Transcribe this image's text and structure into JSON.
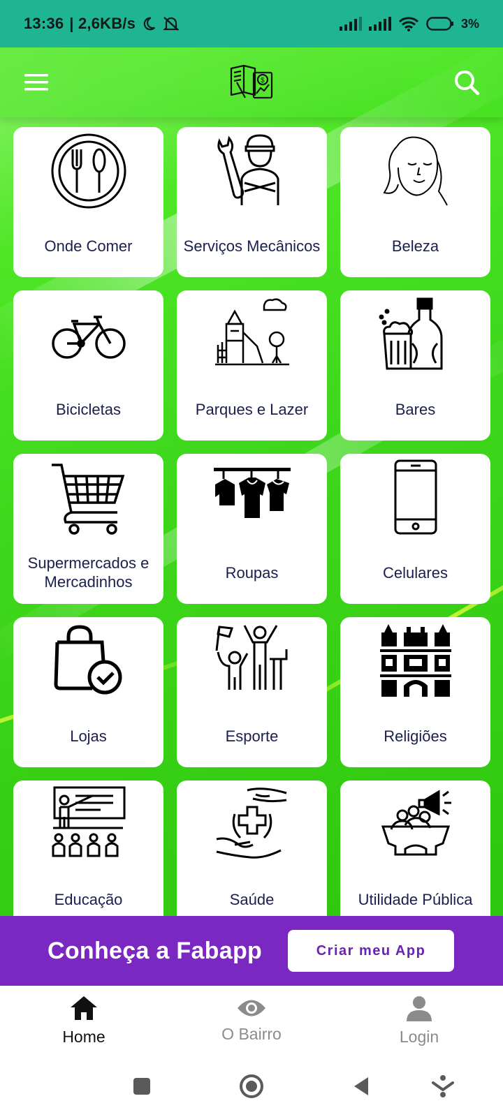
{
  "status_bar": {
    "time": "13:36",
    "speed": "| 2,6KB/s",
    "battery": "3%"
  },
  "app_bar": {
    "menu_icon": "hamburger-menu-icon",
    "logo_icon": "book-money-chart-logo-icon",
    "search_icon": "search-icon"
  },
  "categories": [
    {
      "label": "Onde Comer",
      "icon": "plate-cutlery-icon"
    },
    {
      "label": "Serviços Mecânicos",
      "icon": "mechanic-icon"
    },
    {
      "label": "Beleza",
      "icon": "woman-face-icon"
    },
    {
      "label": "Bicicletas",
      "icon": "bicycle-icon"
    },
    {
      "label": "Parques e Lazer",
      "icon": "playground-icon"
    },
    {
      "label": "Bares",
      "icon": "beer-bottle-icon"
    },
    {
      "label": "Supermercados e Mercadinhos",
      "icon": "shopping-cart-icon"
    },
    {
      "label": "Roupas",
      "icon": "clothes-rack-icon"
    },
    {
      "label": "Celulares",
      "icon": "smartphone-icon"
    },
    {
      "label": "Lojas",
      "icon": "shopping-bag-check-icon"
    },
    {
      "label": "Esporte",
      "icon": "cheering-people-icon"
    },
    {
      "label": "Religiões",
      "icon": "cathedral-icon"
    },
    {
      "label": "Educação",
      "icon": "classroom-teacher-icon"
    },
    {
      "label": "Saúde",
      "icon": "health-hands-cross-icon"
    },
    {
      "label": "Utilidade Pública",
      "icon": "public-utility-megaphone-icon"
    }
  ],
  "banner": {
    "title": "Conheça a Fabapp",
    "button_label": "Criar meu App",
    "color": "#7b27c2"
  },
  "bottom_nav": [
    {
      "label": "Home",
      "icon": "home-icon",
      "active": true
    },
    {
      "label": "O Bairro",
      "icon": "eye-icon",
      "active": false
    },
    {
      "label": "Login",
      "icon": "user-icon",
      "active": false
    }
  ],
  "colors": {
    "status_bar": "#1fb592",
    "green": "#3fd81c",
    "label_text": "#1a1f4d"
  }
}
